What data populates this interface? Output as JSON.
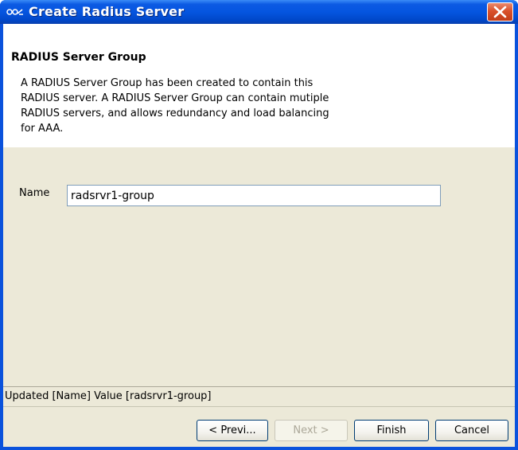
{
  "window": {
    "title": "Create Radius Server",
    "app_icon": "cisco-network-icon",
    "close_icon": "close-icon"
  },
  "header": {
    "title": "RADIUS Server Group",
    "description": "A RADIUS Server Group has been created to contain this\nRADIUS server. A RADIUS Server Group can contain mutiple\nRADIUS servers, and allows redundancy and load balancing\nfor AAA."
  },
  "form": {
    "name_label": "Name",
    "name_value": "radsrvr1-group"
  },
  "status": {
    "message": "Updated [Name] Value [radsrvr1-group]"
  },
  "buttons": {
    "prev": "< Previ...",
    "next": "Next >",
    "finish": "Finish",
    "cancel": "Cancel"
  },
  "colors": {
    "titlebar": "#0555e0",
    "client_bg": "#ece9d8",
    "close_button": "#d9512b"
  }
}
